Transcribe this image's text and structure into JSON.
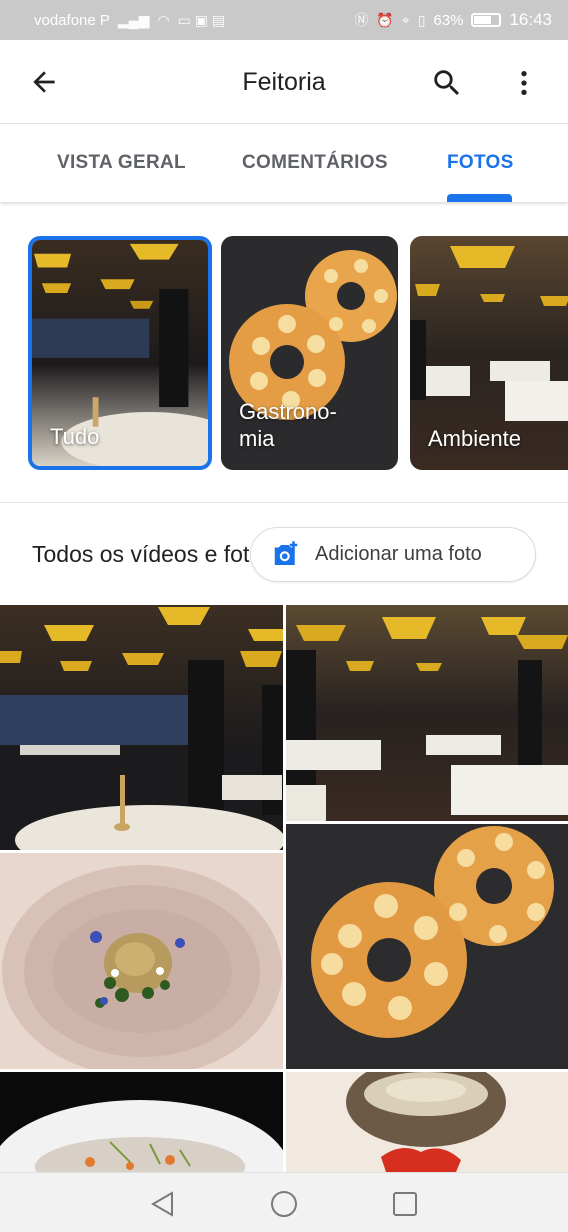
{
  "status_bar": {
    "carrier": "vodafone P",
    "battery": "63%",
    "battery_level": 0.63,
    "time": "16:43"
  },
  "app_bar": {
    "title": "Feitoria",
    "icons": [
      "back-arrow-icon",
      "search-icon",
      "more-vert-icon"
    ]
  },
  "tabs": [
    {
      "label": "VISTA GERAL",
      "selected": false
    },
    {
      "label": "COMENTÁRIOS",
      "selected": false
    },
    {
      "label": "FOTOS",
      "selected": true
    }
  ],
  "categories": [
    {
      "label": "Tudo",
      "selected": true
    },
    {
      "label": "Gastrono-\nmia",
      "selected": false
    },
    {
      "label": "Ambiente",
      "selected": false
    }
  ],
  "section": {
    "title": "Todos os vídeos e fotos",
    "add_photo_label": "Adicionar uma foto"
  },
  "colors": {
    "accent": "#1a73e8",
    "text_primary": "#202124",
    "text_secondary": "#5f6368"
  }
}
